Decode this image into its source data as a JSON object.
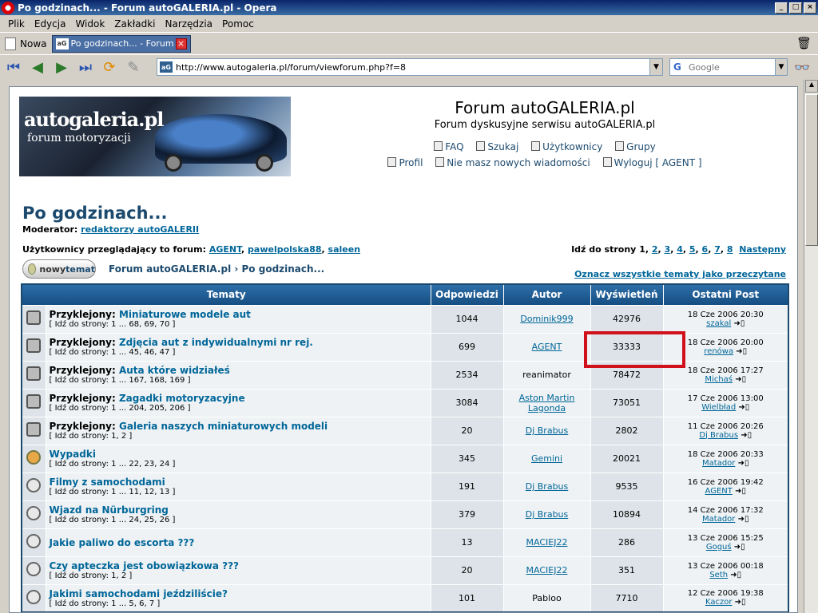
{
  "window": {
    "title": "Po godzinach... - Forum autoGALERIA.pl - Opera",
    "controls": [
      "_",
      "□",
      "×"
    ]
  },
  "menu": [
    "Plik",
    "Edycja",
    "Widok",
    "Zakładki",
    "Narzędzia",
    "Pomoc"
  ],
  "tabs": {
    "new_label": "Nowa",
    "active_tab": "Po godzinach... - Forum a...",
    "favicon": "aG"
  },
  "address": {
    "url": "http://www.autogaleria.pl/forum/viewforum.php?f=8",
    "search_placeholder": "Google"
  },
  "header": {
    "logo_brand": "autogaleria.pl",
    "logo_sub": "forum motoryzacji",
    "title": "Forum autoGALERIA.pl",
    "subtitle": "Forum dyskusyjne serwisu autoGALERIA.pl",
    "links_row1": [
      "FAQ",
      "Szukaj",
      "Użytkownicy",
      "Grupy"
    ],
    "links_row2": [
      "Profil",
      "Nie masz nowych wiadomości",
      "Wyloguj [ AGENT ]"
    ]
  },
  "forum": {
    "name": "Po godzinach...",
    "moderator_label": "Moderator:",
    "moderator": "redaktorzy autoGALERII",
    "viewers_label": "Użytkownicy przeglądający to forum:",
    "viewers": [
      "AGENT",
      "pawelpolska88",
      "saleen"
    ],
    "pager_label": "Idź do strony",
    "pager_current": "1",
    "pager_pages": [
      "2",
      "3",
      "4",
      "5",
      "6",
      "7",
      "8"
    ],
    "pager_next": "Następny",
    "new_topic": "nowytemat",
    "new_topic_prefix": "nowy",
    "new_topic_suffix": "temat",
    "breadcrumb_root": "Forum autoGALERIA.pl",
    "breadcrumb_sep": "›",
    "breadcrumb_current": "Po godzinach...",
    "mark_all": "Oznacz wszystkie tematy jako przeczytane"
  },
  "table": {
    "headers": [
      "Tematy",
      "Odpowiedzi",
      "Autor",
      "Wyświetleń",
      "Ostatni Post"
    ],
    "rows": [
      {
        "icon": "sticky",
        "prefix": "Przyklejony:",
        "title": "Miniaturowe modele aut",
        "pages": "[ Idź do strony: 1 ... 68, 69, 70 ]",
        "replies": "1044",
        "author": "Dominik999",
        "author_link": true,
        "views": "42976",
        "last_date": "18 Cze 2006 20:30",
        "last_user": "szakal"
      },
      {
        "icon": "sticky",
        "prefix": "Przyklejony:",
        "title": "Zdjęcia aut z indywidualnymi nr rej.",
        "pages": "[ Idź do strony: 1 ... 45, 46, 47 ]",
        "replies": "699",
        "author": "AGENT",
        "author_link": true,
        "views": "33333",
        "last_date": "18 Cze 2006 20:00",
        "last_user": "renówa"
      },
      {
        "icon": "sticky",
        "prefix": "Przyklejony:",
        "title": "Auta które widziałeś",
        "pages": "[ Idź do strony: 1 ... 167, 168, 169 ]",
        "replies": "2534",
        "author": "reanimator",
        "author_link": false,
        "views": "78472",
        "last_date": "18 Cze 2006 17:27",
        "last_user": "Michaś"
      },
      {
        "icon": "sticky",
        "prefix": "Przyklejony:",
        "title": "Zagadki motoryzacyjne",
        "pages": "[ Idź do strony: 1 ... 204, 205, 206 ]",
        "replies": "3084",
        "author": "Aston Martin Lagonda",
        "author_link": true,
        "views": "73051",
        "last_date": "17 Cze 2006 13:00",
        "last_user": "Wielbład"
      },
      {
        "icon": "sticky",
        "prefix": "Przyklejony:",
        "title": "Galeria naszych miniaturowych modeli",
        "pages": "[ Idź do strony: 1, 2 ]",
        "replies": "20",
        "author": "Dj Brabus",
        "author_link": true,
        "views": "2802",
        "last_date": "11 Cze 2006 20:26",
        "last_user": "Dj Brabus"
      },
      {
        "icon": "hot",
        "prefix": "",
        "title": "Wypadki",
        "pages": "[ Idź do strony: 1 ... 22, 23, 24 ]",
        "replies": "345",
        "author": "Gemini",
        "author_link": true,
        "views": "20021",
        "last_date": "18 Cze 2006 20:33",
        "last_user": "Matador"
      },
      {
        "icon": "normal",
        "prefix": "",
        "title": "Filmy z samochodami",
        "pages": "[ Idź do strony: 1 ... 11, 12, 13 ]",
        "replies": "191",
        "author": "Dj Brabus",
        "author_link": true,
        "views": "9535",
        "last_date": "16 Cze 2006 19:42",
        "last_user": "AGENT"
      },
      {
        "icon": "normal",
        "prefix": "",
        "title": "Wjazd na Nürburgring",
        "pages": "[ Idź do strony: 1 ... 24, 25, 26 ]",
        "replies": "379",
        "author": "Dj Brabus",
        "author_link": true,
        "views": "10894",
        "last_date": "14 Cze 2006 17:32",
        "last_user": "Matador"
      },
      {
        "icon": "normal",
        "prefix": "",
        "title": "Jakie paliwo do escorta ???",
        "pages": "",
        "replies": "13",
        "author": "MACIEJ22",
        "author_link": true,
        "views": "286",
        "last_date": "13 Cze 2006 15:25",
        "last_user": "Goguś"
      },
      {
        "icon": "normal",
        "prefix": "",
        "title": "Czy apteczka jest obowiązkowa ???",
        "pages": "[ Idź do strony: 1, 2 ]",
        "replies": "20",
        "author": "MACIEJ22",
        "author_link": true,
        "views": "351",
        "last_date": "13 Cze 2006 00:18",
        "last_user": "Seth"
      },
      {
        "icon": "normal",
        "prefix": "",
        "title": "Jakimi samochodami jeździliście?",
        "pages": "[ Idź do strony: 1 ... 5, 6, 7 ]",
        "replies": "101",
        "author": "Pabloo",
        "author_link": false,
        "views": "7710",
        "last_date": "12 Cze 2006 19:38",
        "last_user": "Kaczor"
      }
    ]
  },
  "colors": {
    "accent": "#1c4a6e",
    "link": "#006699",
    "highlight_box": "#d0101a"
  }
}
